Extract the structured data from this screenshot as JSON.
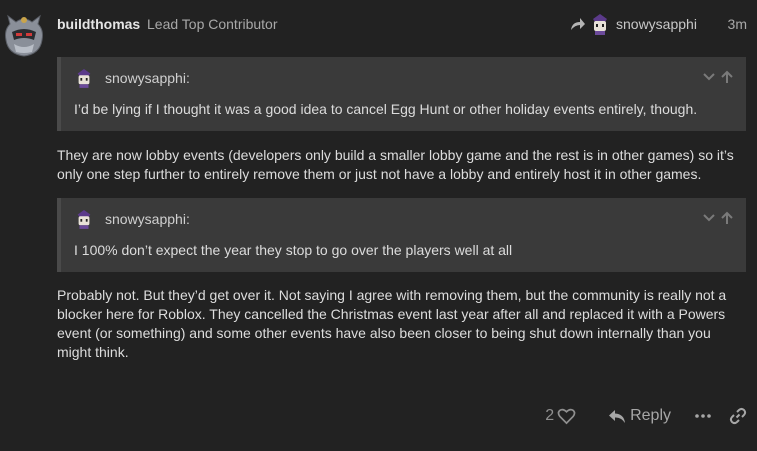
{
  "post": {
    "author": {
      "username": "buildthomas",
      "title": "Lead Top Contributor"
    },
    "reply_to": {
      "username": "snowysapphi"
    },
    "timestamp": "3m",
    "quotes": [
      {
        "username": "snowysapphi:",
        "text": "I’d be lying if I thought it was a good idea to cancel Egg Hunt or other holiday events entirely, though."
      },
      {
        "username": "snowysapphi:",
        "text": "I 100% don’t expect the year they stop to go over the players well at all"
      }
    ],
    "paragraphs": [
      "They are now lobby events (developers only build a smaller lobby game and the rest is in other games) so it’s only one step further to entirely remove them or just not have a lobby and entirely host it in other games.",
      "Probably not. But they’d get over it. Not saying I agree with removing them, but the community is really not a blocker here for Roblox. They cancelled the Christmas event last year after all and replaced it with a Powers event (or something) and some other events have also been closer to being shut down internally than you might think."
    ],
    "actions": {
      "like_count": "2",
      "reply_label": "Reply"
    }
  },
  "icons": {
    "avatar": "knight-helmet-avatar",
    "reply_arrow": "share-arrow-icon",
    "quote_expand": "chevron-down-icon",
    "quote_jump": "arrow-up-icon",
    "like": "heart-icon",
    "reply": "reply-icon",
    "more": "ellipsis-icon",
    "link": "link-icon"
  },
  "colors": {
    "background": "#222222",
    "quote_background": "#3a3a3a",
    "text": "#dddddd",
    "muted": "#a8a8a8"
  }
}
